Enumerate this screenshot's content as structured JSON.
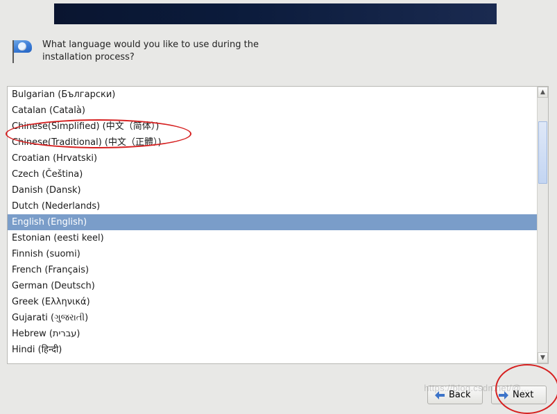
{
  "prompt": {
    "line1": "What language would you like to use during the",
    "line2": "installation process?"
  },
  "languages": [
    {
      "label": "Bulgarian (Български)",
      "selected": false
    },
    {
      "label": "Catalan (Català)",
      "selected": false
    },
    {
      "label": "Chinese(Simplified) (中文（简体）)",
      "selected": false
    },
    {
      "label": "Chinese(Traditional) (中文（正體）)",
      "selected": false
    },
    {
      "label": "Croatian (Hrvatski)",
      "selected": false
    },
    {
      "label": "Czech (Čeština)",
      "selected": false
    },
    {
      "label": "Danish (Dansk)",
      "selected": false
    },
    {
      "label": "Dutch (Nederlands)",
      "selected": false
    },
    {
      "label": "English (English)",
      "selected": true
    },
    {
      "label": "Estonian (eesti keel)",
      "selected": false
    },
    {
      "label": "Finnish (suomi)",
      "selected": false
    },
    {
      "label": "French (Français)",
      "selected": false
    },
    {
      "label": "German (Deutsch)",
      "selected": false
    },
    {
      "label": "Greek (Ελληνικά)",
      "selected": false
    },
    {
      "label": "Gujarati (ગુજરાતી)",
      "selected": false
    },
    {
      "label": "Hebrew (עברית)",
      "selected": false
    },
    {
      "label": "Hindi (हिन्दी)",
      "selected": false
    }
  ],
  "buttons": {
    "back": "Back",
    "next": "Next"
  },
  "watermark": "https://blog.csdn.net/@...",
  "colors": {
    "selection_bg": "#7a9dc9",
    "annotation": "#d62020"
  }
}
